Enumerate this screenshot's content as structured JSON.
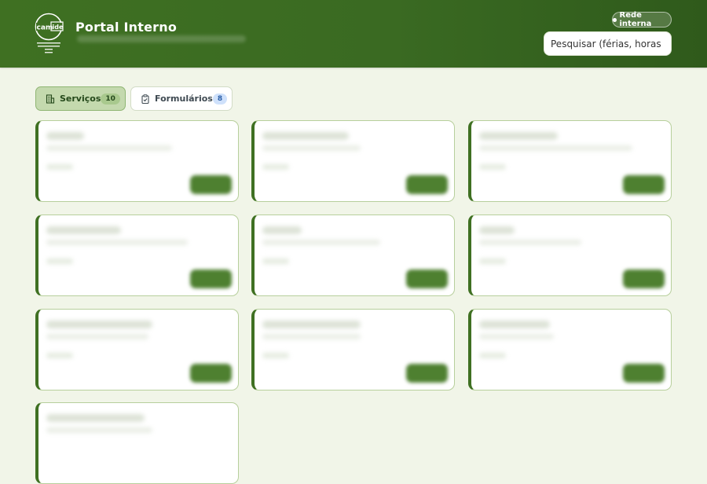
{
  "header": {
    "title": "Portal Interno",
    "logo": {
      "name": "camide-logo"
    },
    "status_badge": "Rede interna",
    "search": {
      "placeholder": "Pesquisar (férias, horas extra, c"
    }
  },
  "tabs": [
    {
      "label": "Serviços",
      "count": "10",
      "icon": "building-icon",
      "active": true
    },
    {
      "label": "Formulários",
      "count": "8",
      "icon": "clipboard-icon",
      "active": false
    }
  ],
  "colors": {
    "header_green": "#3f7022",
    "background": "#f1f5e8",
    "card_accent": "#3f7022",
    "active_tab": "#c4d9ae",
    "form_count_badge": "#cfe1fb"
  }
}
